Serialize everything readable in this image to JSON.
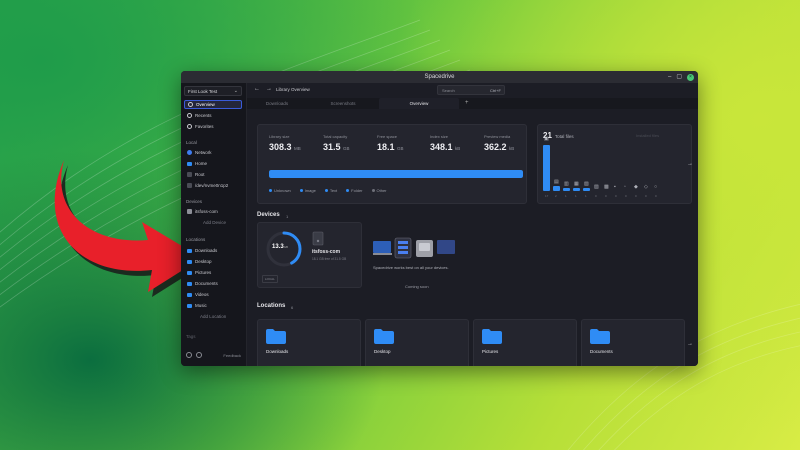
{
  "window": {
    "title": "Spacedrive"
  },
  "sidebar": {
    "library_name": "First Look Test",
    "nav": [
      {
        "label": "Overview",
        "icon": "overview-icon"
      },
      {
        "label": "Recents",
        "icon": "clock-icon"
      },
      {
        "label": "Favorites",
        "icon": "heart-icon"
      }
    ],
    "local_heading": "Local",
    "local": [
      {
        "label": "Network",
        "icon": "globe-icon"
      },
      {
        "label": "Home",
        "icon": "folder-icon"
      },
      {
        "label": "Root",
        "icon": "drive-icon"
      },
      {
        "label": "/dev/nvme0n1p2",
        "icon": "drive-icon"
      }
    ],
    "devices_heading": "Devices",
    "device_item": "itsfoss-com",
    "add_device": "Add Device",
    "locations_heading": "Locations",
    "locations": [
      "Downloads",
      "Desktop",
      "Pictures",
      "Documents",
      "Videos",
      "Music"
    ],
    "add_location": "Add Location",
    "tags_heading": "Tags",
    "feedback": "Feedback"
  },
  "topbar": {
    "breadcrumb": "Library Overview",
    "search_placeholder": "Search",
    "search_shortcut": "Ctrl+F"
  },
  "tabs": [
    "Downloads",
    "Screenshots",
    "Overview"
  ],
  "stats": [
    {
      "label": "Library size",
      "value": "308.3",
      "unit": "MB"
    },
    {
      "label": "Total capacity",
      "value": "31.5",
      "unit": "GB"
    },
    {
      "label": "Free space",
      "value": "18.1",
      "unit": "GB"
    },
    {
      "label": "Index size",
      "value": "348.1",
      "unit": "kB"
    },
    {
      "label": "Preview media",
      "value": "362.2",
      "unit": "kB"
    }
  ],
  "usage": {
    "fill_fraction": 1.0,
    "color": "#2f8cf5"
  },
  "legend": [
    {
      "label": "Unknown",
      "color": "#2f8cf5"
    },
    {
      "label": "Image",
      "color": "#2f8cf5"
    },
    {
      "label": "Text",
      "color": "#2f8cf5"
    },
    {
      "label": "Folder",
      "color": "#2f8cf5"
    },
    {
      "label": "Other",
      "color": "#6e7079"
    }
  ],
  "files": {
    "count": "21",
    "label": "Total files",
    "bar_counts": [
      17,
      2,
      1,
      1,
      1,
      0,
      0,
      0,
      0,
      0,
      0,
      0
    ],
    "bar_labels": [
      "17",
      "2",
      "1",
      "1",
      "1",
      "0",
      "0",
      "0",
      "0",
      "0",
      "0",
      "0"
    ]
  },
  "devices_section": {
    "title": "Devices",
    "badge": "1",
    "device": {
      "ring_value": "13.3",
      "ring_unit": "GB",
      "ring_fraction": 0.42,
      "name": "itsfoss-com",
      "sub": "18.1 GB free of 31.5 GB",
      "tag": "LOCAL"
    },
    "promo_text": "Spacedrive works best on all your devices.",
    "promo_soon": "Coming soon"
  },
  "locations_section": {
    "title": "Locations",
    "badge": "6",
    "cards": [
      "Downloads",
      "Desktop",
      "Pictures",
      "Documents"
    ]
  },
  "colors": {
    "accent": "#2f8cf5",
    "arrow": "#e8202a"
  }
}
